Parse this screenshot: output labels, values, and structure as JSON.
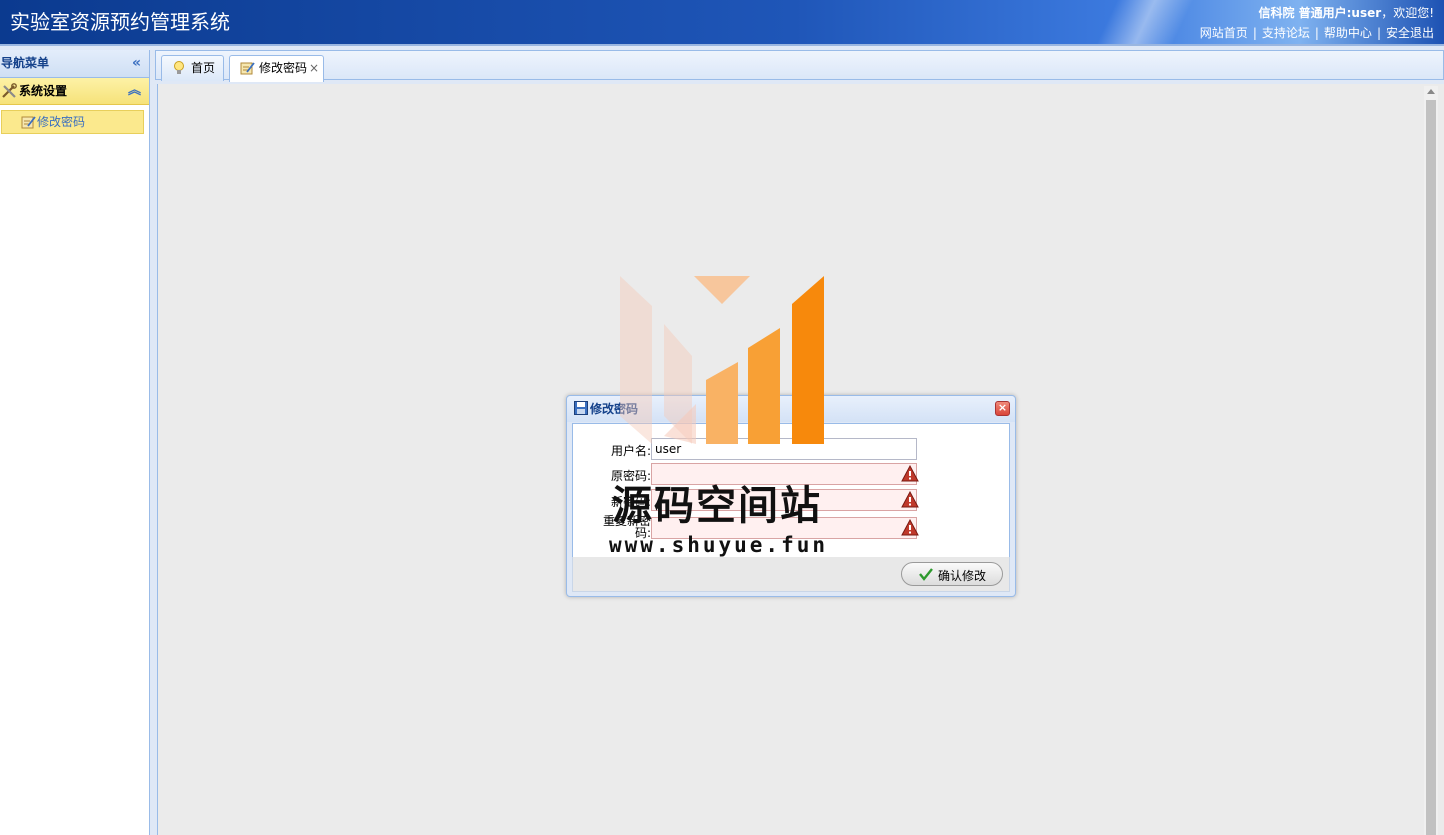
{
  "header": {
    "app_title": "实验室资源预约管理系统",
    "user_bold": "信科院 普通用户:user",
    "welcome": "，欢迎您!",
    "links": [
      "网站首页",
      "支持论坛",
      "帮助中心",
      "安全退出"
    ],
    "separator": "|"
  },
  "sidebar": {
    "title": "导航菜单",
    "collapse_icon": "double-chevron-left-icon",
    "group": {
      "label": "系统设置",
      "icon": "tools-icon",
      "toggle_icon": "double-chevron-up-icon"
    },
    "items": [
      {
        "label": "修改密码",
        "icon": "edit-doc-icon",
        "selected": true
      }
    ]
  },
  "tabs": [
    {
      "label": "首页",
      "icon": "lightbulb-icon",
      "active": false,
      "closable": false
    },
    {
      "label": "修改密码",
      "icon": "edit-doc-icon",
      "active": true,
      "closable": true,
      "close_glyph": "×"
    }
  ],
  "dialog": {
    "title": "修改密码",
    "close_glyph": "×",
    "fields": [
      {
        "label": "用户名:",
        "value": "user",
        "invalid": false
      },
      {
        "label": "原密码:",
        "value": "",
        "invalid": true
      },
      {
        "label": "新密码:",
        "value": "",
        "invalid": true
      },
      {
        "label": "重复新密码:",
        "value": "",
        "invalid": true
      }
    ],
    "confirm_label": "确认修改"
  },
  "watermark": {
    "text": "源码空间站",
    "url": "www.shuyue.fun"
  },
  "colors": {
    "header_blue": "#1f56b8",
    "panel_border": "#99bbe8",
    "menu_highlight": "#fbe98d",
    "watermark_orange": "#f7890c"
  }
}
